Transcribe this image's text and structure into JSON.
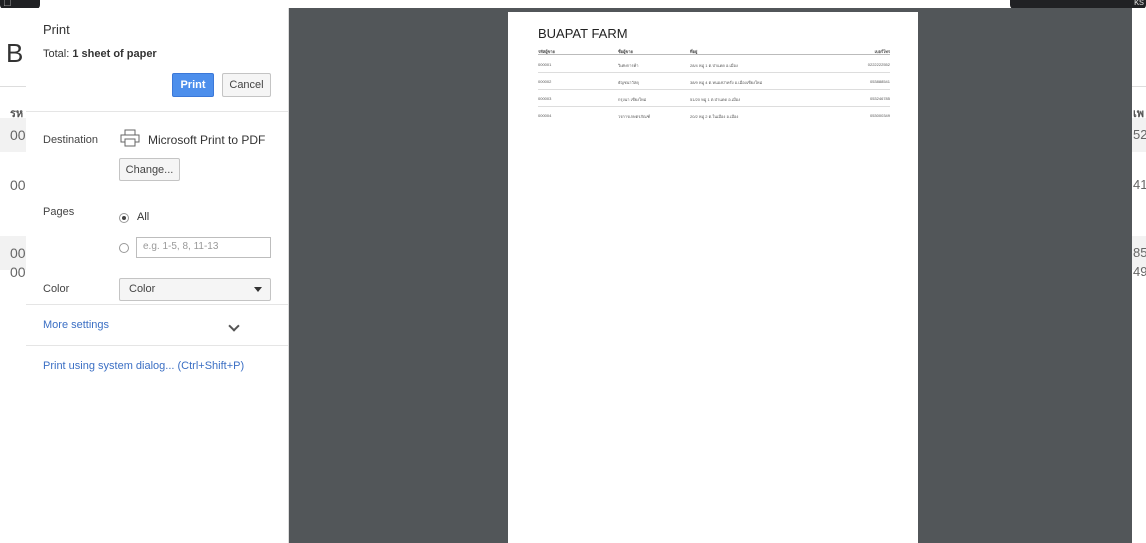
{
  "dialog": {
    "title": "Print",
    "total_prefix": "Total: ",
    "total_value": "1 sheet of paper",
    "print_label": "Print",
    "cancel_label": "Cancel",
    "destination": {
      "label": "Destination",
      "name": "Microsoft Print to PDF",
      "change_label": "Change..."
    },
    "pages": {
      "label": "Pages",
      "all_label": "All",
      "custom_placeholder": "e.g. 1-5, 8, 11-13",
      "selected": "All"
    },
    "color": {
      "label": "Color",
      "selected": "Color"
    },
    "more_settings_label": "More settings",
    "system_dialog_label": "Print using system dialog... (Ctrl+Shift+P)"
  },
  "preview": {
    "doc_title": "BUAPAT FARM",
    "headers": [
      "รหัสผู้ขาย",
      "ชื่อผู้ขาย",
      "ที่อยู่",
      "เบอร์โทร"
    ],
    "rows": [
      [
        "000001",
        "วิเศษการค้า",
        "28/4 หมู่ 1 ต.ป่าแดด อ.เมือง",
        "0222222552"
      ],
      [
        "000002",
        "ธัญชนาวัสดุ",
        "38/9 หมู่ 4 ต.หนองป่าครั่ง อ.เมืองเชียงใหม่",
        "053888541"
      ],
      [
        "000003",
        "กรุงนา เชียงใหม่",
        "51/20 หมู่ 1 ต.ป่าแดด อ.เมือง",
        "053246785"
      ],
      [
        "000004",
        "วรการเกษตรภัณฑ์",
        "20/2 หมู่ 2 ต.ในเมือง อ.เมือง",
        "053000349"
      ]
    ]
  },
  "background_page": {
    "heading_initial": "B",
    "header_left_fragment": "รห",
    "header_right_fragment": "เพ",
    "left_cells": [
      "00",
      "00",
      "00",
      "00"
    ],
    "right_cells": [
      "52",
      "41",
      "85",
      "49"
    ],
    "tab_right_fragment": "ks"
  }
}
